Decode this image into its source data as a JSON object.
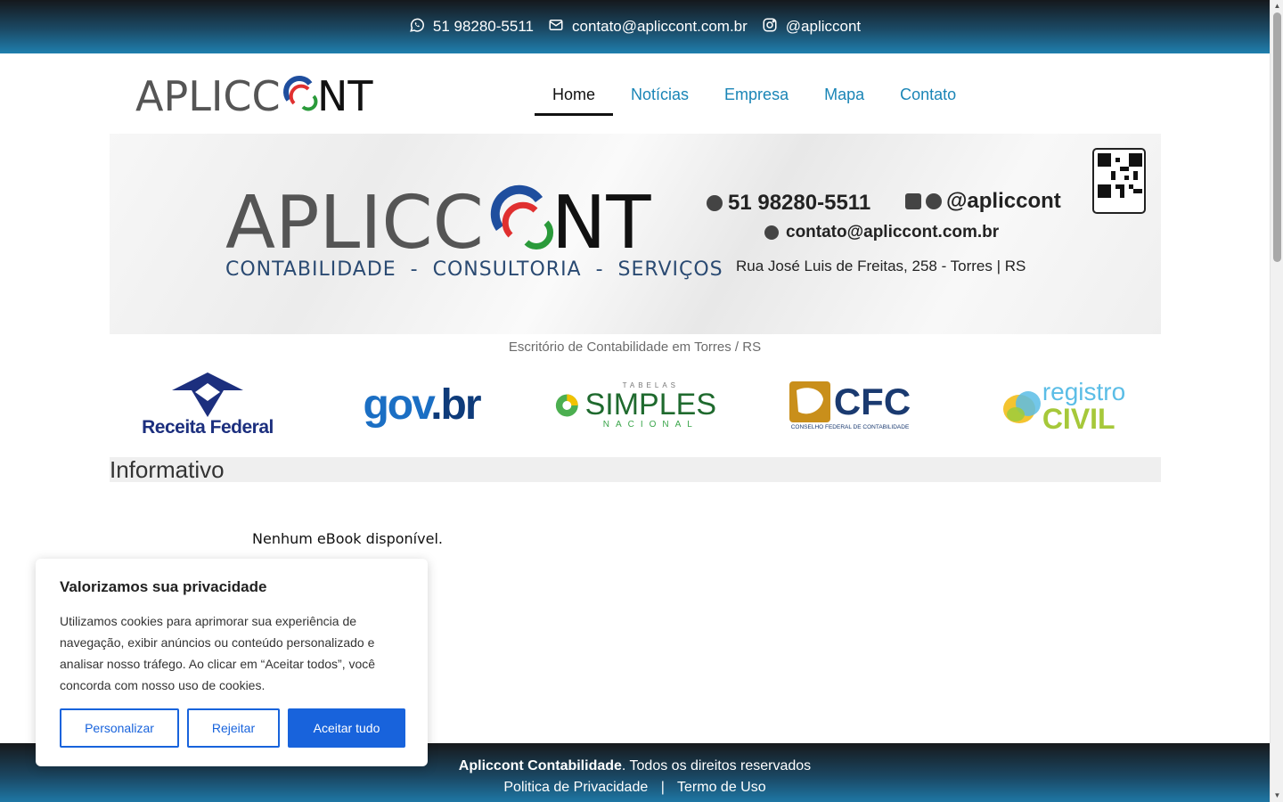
{
  "topbar": {
    "phone": "51 98280-5511",
    "email": "contato@apliccont.com.br",
    "instagram": "@apliccont"
  },
  "header": {
    "logo_text": "APLICC",
    "logo_text_end": "NT",
    "nav": [
      {
        "label": "Home",
        "active": true
      },
      {
        "label": "Notícias",
        "active": false
      },
      {
        "label": "Empresa",
        "active": false
      },
      {
        "label": "Mapa",
        "active": false
      },
      {
        "label": "Contato",
        "active": false
      }
    ]
  },
  "banner": {
    "name": "APLICC",
    "name_end": "NT",
    "tagline": "CONTABILIDADE  -  CONSULTORIA  -  SERVIÇOS",
    "phone": "51 98280-5511",
    "social": "@apliccont",
    "email": "contato@apliccont.com.br",
    "address": "Rua José Luis de Freitas, 258 - Torres | RS"
  },
  "subtitle": "Escritório de Contabilidade em Torres / RS",
  "partners": {
    "receita": "Receita Federal",
    "govbr_a": "gov",
    "govbr_b": ".br",
    "simples_top": "TABELAS",
    "simples_main": "SIMPLES",
    "simples_sub": "NACIONAL",
    "cfc_main": "CFC",
    "cfc_sub": "CONSELHO FEDERAL DE CONTABILIDADE",
    "registro_a": "registro",
    "registro_b": "CIVIL"
  },
  "section": {
    "title": "Informativo",
    "empty_message": "Nenhum eBook disponível."
  },
  "footer": {
    "company": "Apliccont Contabilidade",
    "rights": ".  Todos os direitos reservados",
    "privacy": "Politica de Privacidade",
    "separator": "|",
    "terms": "Termo de Uso"
  },
  "cookie": {
    "title": "Valorizamos sua privacidade",
    "text": "Utilizamos cookies para aprimorar sua experiência de navegação, exibir anúncios ou conteúdo personalizado e analisar nosso tráfego. Ao clicar em “Aceitar todos”, você concorda com nosso uso de cookies.",
    "customize": "Personalizar",
    "reject": "Rejeitar",
    "accept": "Aceitar tudo"
  },
  "colors": {
    "brand_blue": "#1a85b6",
    "accent_button": "#1863dc",
    "header_dark": "#15181c"
  }
}
